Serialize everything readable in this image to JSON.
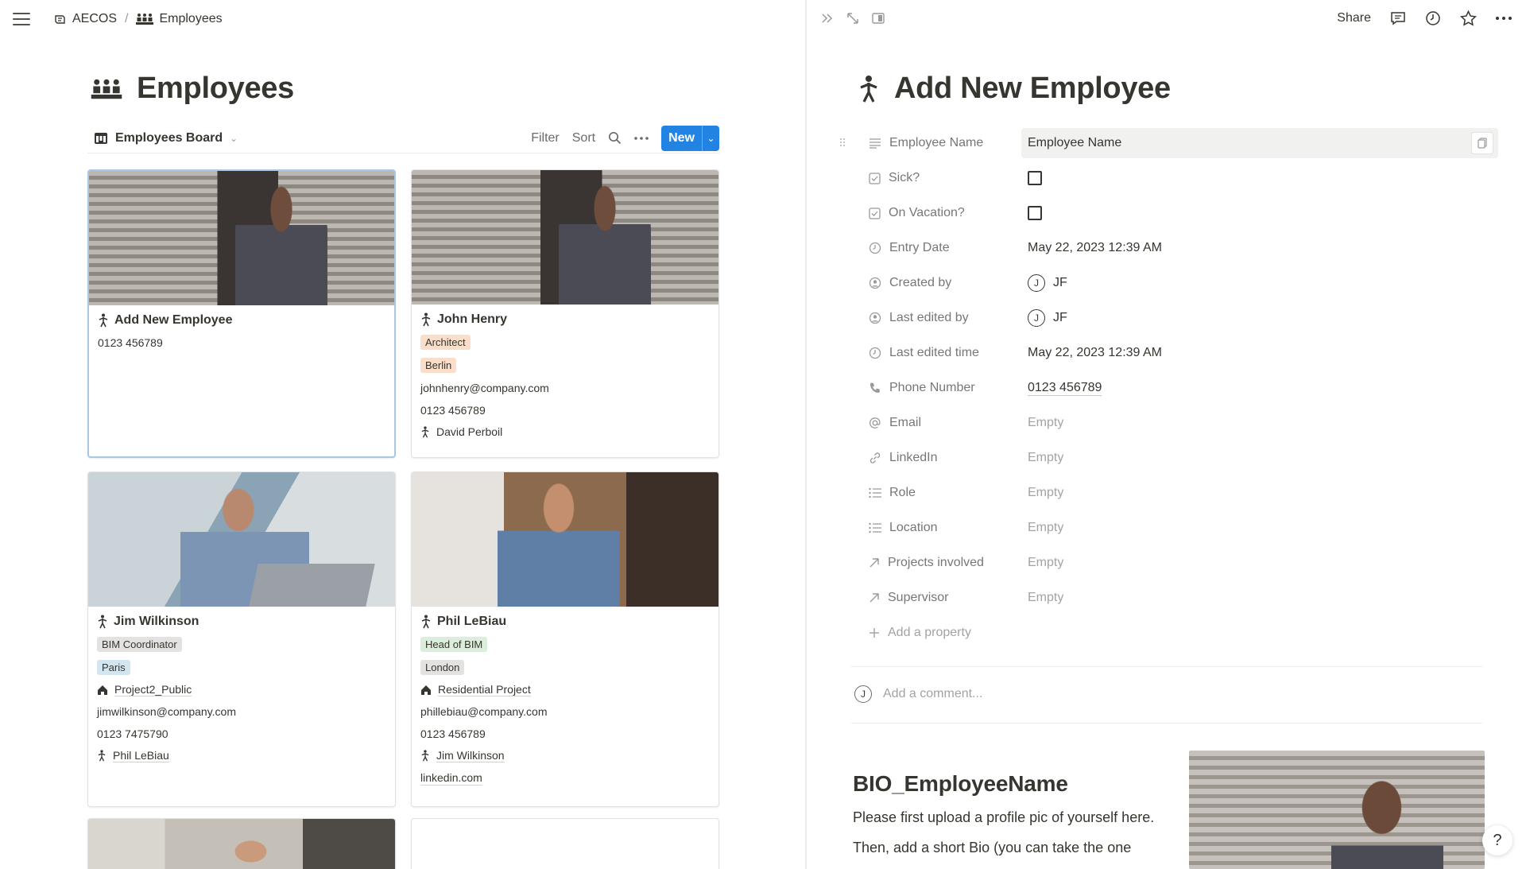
{
  "breadcrumb": {
    "workspace": "AECOS",
    "page": "Employees"
  },
  "page": {
    "title": "Employees"
  },
  "view": {
    "name": "Employees Board",
    "filter_label": "Filter",
    "sort_label": "Sort",
    "new_label": "New"
  },
  "cards": [
    {
      "title": "Add New Employee",
      "phone": "0123 456789"
    },
    {
      "title": "John Henry",
      "role": "Architect",
      "location": "Berlin",
      "email": "johnhenry@company.com",
      "phone": "0123 456789",
      "supervisor": "David Perboil"
    },
    {
      "title": "Jim Wilkinson",
      "role": "BIM Coordinator",
      "location": "Paris",
      "project": "Project2_Public",
      "email": "jimwilkinson@company.com",
      "phone": "0123 7475790",
      "supervisor": "Phil LeBiau"
    },
    {
      "title": "Phil LeBiau",
      "role": "Head of BIM",
      "location": "London",
      "project": "Residential Project",
      "email": "phillebiau@company.com",
      "phone": "0123 456789",
      "supervisor": "Jim Wilkinson",
      "linkedin": "linkedin.com"
    }
  ],
  "tag_colors": {
    "Architect": "#fadec9",
    "Berlin": "#fadec9",
    "BIM Coordinator": "#e3e2e0",
    "Paris": "#d3e5ef",
    "Head of BIM": "#dbeddb",
    "London": "#e3e2e0"
  },
  "topbar": {
    "share_label": "Share"
  },
  "detail": {
    "title": "Add New Employee",
    "properties": {
      "employee_name": {
        "label": "Employee Name",
        "value": "Employee Name"
      },
      "sick": {
        "label": "Sick?"
      },
      "vacation": {
        "label": "On Vacation?"
      },
      "entry_date": {
        "label": "Entry Date",
        "value": "May 22, 2023 12:39 AM"
      },
      "created_by": {
        "label": "Created by",
        "initial": "J",
        "value": "JF"
      },
      "last_edited_by": {
        "label": "Last edited by",
        "initial": "J",
        "value": "JF"
      },
      "last_edited_time": {
        "label": "Last edited time",
        "value": "May 22, 2023 12:39 AM"
      },
      "phone": {
        "label": "Phone Number",
        "value": "0123 456789"
      },
      "email": {
        "label": "Email",
        "value": "Empty"
      },
      "linkedin": {
        "label": "LinkedIn",
        "value": "Empty"
      },
      "role": {
        "label": "Role",
        "value": "Empty"
      },
      "location": {
        "label": "Location",
        "value": "Empty"
      },
      "projects": {
        "label": "Projects involved",
        "value": "Empty"
      },
      "supervisor": {
        "label": "Supervisor",
        "value": "Empty"
      }
    },
    "add_property_label": "Add a property",
    "comment": {
      "initial": "J",
      "placeholder": "Add a comment..."
    },
    "bio": {
      "heading": "BIO_EmployeeName",
      "text1": "Please first upload a profile pic of yourself here.",
      "text2": "Then, add a short Bio (you can take the one"
    }
  },
  "help_label": "?"
}
